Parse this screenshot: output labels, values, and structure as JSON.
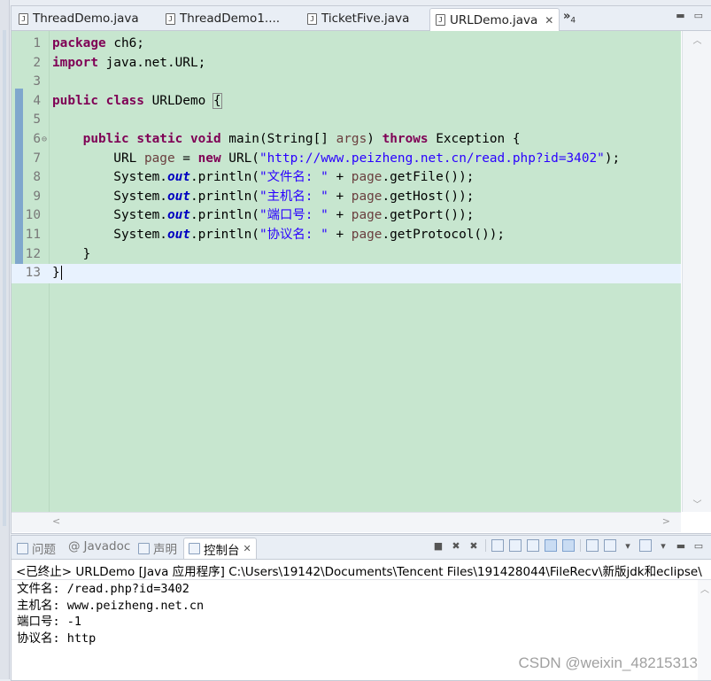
{
  "editor": {
    "tabs": [
      {
        "label": "ThreadDemo.java",
        "icon": "java-file-icon"
      },
      {
        "label": "ThreadDemo1....",
        "icon": "java-file-icon"
      },
      {
        "label": "TicketFive.java",
        "icon": "java-file-icon"
      },
      {
        "label": "URLDemo.java",
        "icon": "java-file-icon",
        "active": true
      }
    ],
    "tab_overflow": "»",
    "tab_overflow_count": "4",
    "lines": [
      {
        "n": "1",
        "code": "package ch6;"
      },
      {
        "n": "2",
        "code": "import java.net.URL;"
      },
      {
        "n": "3",
        "code": ""
      },
      {
        "n": "4",
        "code": "public class URLDemo {"
      },
      {
        "n": "5",
        "code": ""
      },
      {
        "n": "6",
        "code": "    public static void main(String[] args) throws Exception {"
      },
      {
        "n": "7",
        "code": "        URL page = new URL(\"http://www.peizheng.net.cn/read.php?id=3402\");"
      },
      {
        "n": "8",
        "code": "        System.out.println(\"文件名: \" + page.getFile());"
      },
      {
        "n": "9",
        "code": "        System.out.println(\"主机名: \" + page.getHost());"
      },
      {
        "n": "10",
        "code": "        System.out.println(\"端口号: \" + page.getPort());"
      },
      {
        "n": "11",
        "code": "        System.out.println(\"协议名: \" + page.getProtocol());"
      },
      {
        "n": "12",
        "code": "    }"
      },
      {
        "n": "13",
        "code": "}"
      }
    ],
    "colors": {
      "background": "#c7e6cf",
      "keyword": "#7f0055",
      "string": "#2a00ff",
      "current_line": "#e8f2fe"
    }
  },
  "console": {
    "tabs": [
      {
        "label": "问题",
        "icon": "problems-icon"
      },
      {
        "label": "Javadoc",
        "icon": "javadoc-icon"
      },
      {
        "label": "声明",
        "icon": "declaration-icon"
      },
      {
        "label": "控制台",
        "icon": "console-icon",
        "active": true
      }
    ],
    "status": "<已终止> URLDemo [Java 应用程序] C:\\Users\\19142\\Documents\\Tencent Files\\191428044\\FileRecv\\新版jdk和eclipse\\",
    "output": [
      "文件名: /read.php?id=3402",
      "主机名: www.peizheng.net.cn",
      "端口号: -1",
      "协议名: http"
    ]
  },
  "watermark": "CSDN @weixin_48215313"
}
